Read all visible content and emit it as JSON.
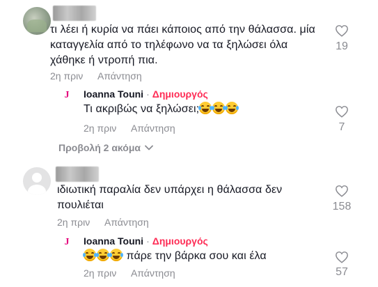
{
  "comments": [
    {
      "text_lines": [
        "τι λέει ή κυρία να πάει κάποιος από την θάλασσα. μία",
        "καταγγελία από το τηλέφωνο να τα ξηλώσει όλα",
        "χάθηκε ή ντροπή πια."
      ],
      "time": "2η πριν",
      "reply_label": "Απάντηση",
      "likes": "19"
    },
    {
      "text_lines": [
        "ιδιωτική παραλία δεν υπάρχει η θάλασσα δεν",
        "πουλιέται"
      ],
      "time": "2η πριν",
      "reply_label": "Απάντηση",
      "likes": "158"
    }
  ],
  "replies": [
    {
      "author": "Ioanna Touni",
      "separator": "·",
      "badge": "Δημιουργός",
      "text": "Τι ακριβώς να ξηλώσει;",
      "emoji_count": 3,
      "time": "2η πριν",
      "reply_label": "Απάντηση",
      "likes": "7"
    },
    {
      "author": "Ioanna Touni",
      "separator": "·",
      "badge": "Δημιουργός",
      "text": " πάρε την βάρκα σου και έλα",
      "emoji_count": 3,
      "time": "2η πριν",
      "reply_label": "Απάντηση",
      "likes": "57"
    }
  ],
  "view_more_label": "Προβολή 2 ακόμα",
  "colors": {
    "creator_badge": "#fe2c55",
    "muted": "#8a8b91",
    "text": "#161823"
  }
}
